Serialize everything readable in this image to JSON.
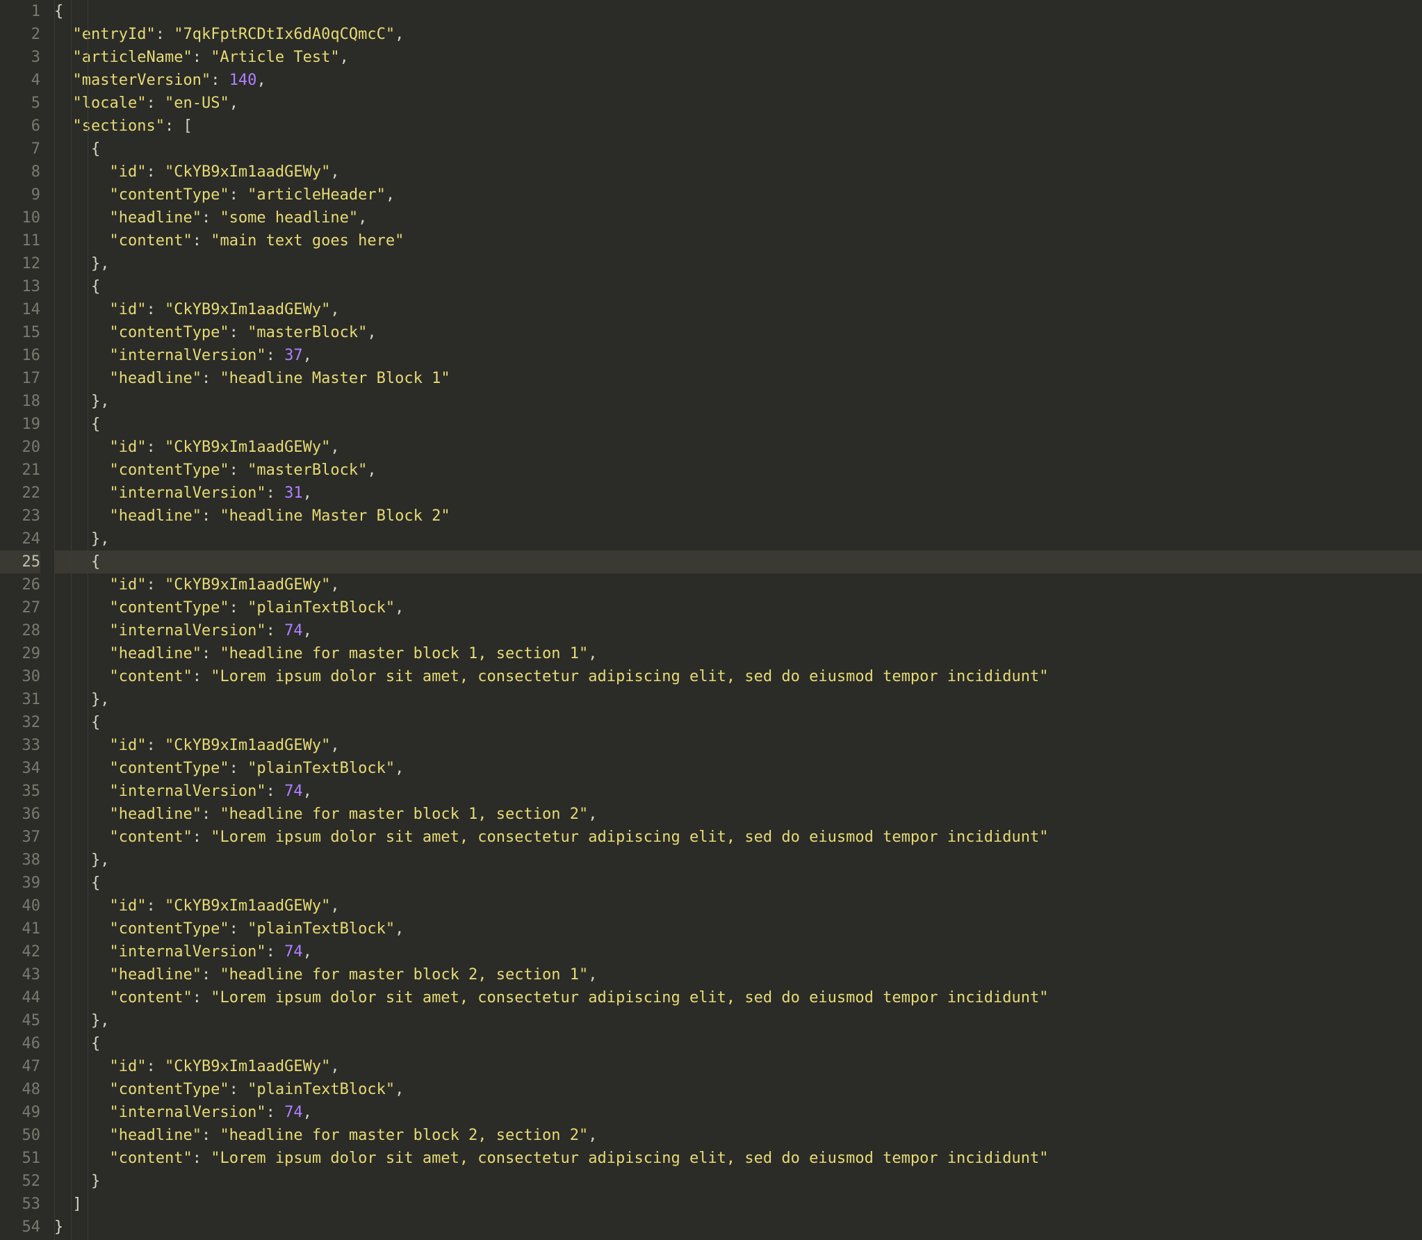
{
  "activeLine": 25,
  "lines": [
    {
      "n": 1,
      "indent": 0,
      "tokens": [
        {
          "t": "pn",
          "v": "{"
        }
      ]
    },
    {
      "n": 2,
      "indent": 1,
      "tokens": [
        {
          "t": "key",
          "v": "\"entryId\""
        },
        {
          "t": "pn",
          "v": ": "
        },
        {
          "t": "str",
          "v": "\"7qkFptRCDtIx6dA0qCQmcC\""
        },
        {
          "t": "pn",
          "v": ","
        }
      ]
    },
    {
      "n": 3,
      "indent": 1,
      "tokens": [
        {
          "t": "key",
          "v": "\"articleName\""
        },
        {
          "t": "pn",
          "v": ": "
        },
        {
          "t": "str",
          "v": "\"Article Test\""
        },
        {
          "t": "pn",
          "v": ","
        }
      ]
    },
    {
      "n": 4,
      "indent": 1,
      "tokens": [
        {
          "t": "key",
          "v": "\"masterVersion\""
        },
        {
          "t": "pn",
          "v": ": "
        },
        {
          "t": "num",
          "v": "140"
        },
        {
          "t": "pn",
          "v": ","
        }
      ]
    },
    {
      "n": 5,
      "indent": 1,
      "tokens": [
        {
          "t": "key",
          "v": "\"locale\""
        },
        {
          "t": "pn",
          "v": ": "
        },
        {
          "t": "str",
          "v": "\"en-US\""
        },
        {
          "t": "pn",
          "v": ","
        }
      ]
    },
    {
      "n": 6,
      "indent": 1,
      "tokens": [
        {
          "t": "key",
          "v": "\"sections\""
        },
        {
          "t": "pn",
          "v": ": ["
        }
      ]
    },
    {
      "n": 7,
      "indent": 2,
      "tokens": [
        {
          "t": "pn",
          "v": "{"
        }
      ]
    },
    {
      "n": 8,
      "indent": 3,
      "tokens": [
        {
          "t": "key",
          "v": "\"id\""
        },
        {
          "t": "pn",
          "v": ": "
        },
        {
          "t": "str",
          "v": "\"CkYB9xIm1aadGEWy\""
        },
        {
          "t": "pn",
          "v": ","
        }
      ]
    },
    {
      "n": 9,
      "indent": 3,
      "tokens": [
        {
          "t": "key",
          "v": "\"contentType\""
        },
        {
          "t": "pn",
          "v": ": "
        },
        {
          "t": "str",
          "v": "\"articleHeader\""
        },
        {
          "t": "pn",
          "v": ","
        }
      ]
    },
    {
      "n": 10,
      "indent": 3,
      "tokens": [
        {
          "t": "key",
          "v": "\"headline\""
        },
        {
          "t": "pn",
          "v": ": "
        },
        {
          "t": "str",
          "v": "\"some headline\""
        },
        {
          "t": "pn",
          "v": ","
        }
      ]
    },
    {
      "n": 11,
      "indent": 3,
      "tokens": [
        {
          "t": "key",
          "v": "\"content\""
        },
        {
          "t": "pn",
          "v": ": "
        },
        {
          "t": "str",
          "v": "\"main text goes here\""
        }
      ]
    },
    {
      "n": 12,
      "indent": 2,
      "tokens": [
        {
          "t": "pn",
          "v": "},"
        }
      ]
    },
    {
      "n": 13,
      "indent": 2,
      "tokens": [
        {
          "t": "pn",
          "v": "{"
        }
      ]
    },
    {
      "n": 14,
      "indent": 3,
      "tokens": [
        {
          "t": "key",
          "v": "\"id\""
        },
        {
          "t": "pn",
          "v": ": "
        },
        {
          "t": "str",
          "v": "\"CkYB9xIm1aadGEWy\""
        },
        {
          "t": "pn",
          "v": ","
        }
      ]
    },
    {
      "n": 15,
      "indent": 3,
      "tokens": [
        {
          "t": "key",
          "v": "\"contentType\""
        },
        {
          "t": "pn",
          "v": ": "
        },
        {
          "t": "str",
          "v": "\"masterBlock\""
        },
        {
          "t": "pn",
          "v": ","
        }
      ]
    },
    {
      "n": 16,
      "indent": 3,
      "tokens": [
        {
          "t": "key",
          "v": "\"internalVersion\""
        },
        {
          "t": "pn",
          "v": ": "
        },
        {
          "t": "num",
          "v": "37"
        },
        {
          "t": "pn",
          "v": ","
        }
      ]
    },
    {
      "n": 17,
      "indent": 3,
      "tokens": [
        {
          "t": "key",
          "v": "\"headline\""
        },
        {
          "t": "pn",
          "v": ": "
        },
        {
          "t": "str",
          "v": "\"headline Master Block 1\""
        }
      ]
    },
    {
      "n": 18,
      "indent": 2,
      "tokens": [
        {
          "t": "pn",
          "v": "},"
        }
      ]
    },
    {
      "n": 19,
      "indent": 2,
      "tokens": [
        {
          "t": "pn",
          "v": "{"
        }
      ]
    },
    {
      "n": 20,
      "indent": 3,
      "tokens": [
        {
          "t": "key",
          "v": "\"id\""
        },
        {
          "t": "pn",
          "v": ": "
        },
        {
          "t": "str",
          "v": "\"CkYB9xIm1aadGEWy\""
        },
        {
          "t": "pn",
          "v": ","
        }
      ]
    },
    {
      "n": 21,
      "indent": 3,
      "tokens": [
        {
          "t": "key",
          "v": "\"contentType\""
        },
        {
          "t": "pn",
          "v": ": "
        },
        {
          "t": "str",
          "v": "\"masterBlock\""
        },
        {
          "t": "pn",
          "v": ","
        }
      ]
    },
    {
      "n": 22,
      "indent": 3,
      "tokens": [
        {
          "t": "key",
          "v": "\"internalVersion\""
        },
        {
          "t": "pn",
          "v": ": "
        },
        {
          "t": "num",
          "v": "31"
        },
        {
          "t": "pn",
          "v": ","
        }
      ]
    },
    {
      "n": 23,
      "indent": 3,
      "tokens": [
        {
          "t": "key",
          "v": "\"headline\""
        },
        {
          "t": "pn",
          "v": ": "
        },
        {
          "t": "str",
          "v": "\"headline Master Block 2\""
        }
      ]
    },
    {
      "n": 24,
      "indent": 2,
      "tokens": [
        {
          "t": "pn",
          "v": "},"
        }
      ]
    },
    {
      "n": 25,
      "indent": 2,
      "tokens": [
        {
          "t": "pn",
          "v": "{"
        }
      ]
    },
    {
      "n": 26,
      "indent": 3,
      "tokens": [
        {
          "t": "key",
          "v": "\"id\""
        },
        {
          "t": "pn",
          "v": ": "
        },
        {
          "t": "str",
          "v": "\"CkYB9xIm1aadGEWy\""
        },
        {
          "t": "pn",
          "v": ","
        }
      ]
    },
    {
      "n": 27,
      "indent": 3,
      "tokens": [
        {
          "t": "key",
          "v": "\"contentType\""
        },
        {
          "t": "pn",
          "v": ": "
        },
        {
          "t": "str",
          "v": "\"plainTextBlock\""
        },
        {
          "t": "pn",
          "v": ","
        }
      ]
    },
    {
      "n": 28,
      "indent": 3,
      "tokens": [
        {
          "t": "key",
          "v": "\"internalVersion\""
        },
        {
          "t": "pn",
          "v": ": "
        },
        {
          "t": "num",
          "v": "74"
        },
        {
          "t": "pn",
          "v": ","
        }
      ]
    },
    {
      "n": 29,
      "indent": 3,
      "tokens": [
        {
          "t": "key",
          "v": "\"headline\""
        },
        {
          "t": "pn",
          "v": ": "
        },
        {
          "t": "str",
          "v": "\"headline for master block 1, section 1\""
        },
        {
          "t": "pn",
          "v": ","
        }
      ]
    },
    {
      "n": 30,
      "indent": 3,
      "tokens": [
        {
          "t": "key",
          "v": "\"content\""
        },
        {
          "t": "pn",
          "v": ": "
        },
        {
          "t": "str",
          "v": "\"Lorem ipsum dolor sit amet, consectetur adipiscing elit, sed do eiusmod tempor incididunt\""
        }
      ]
    },
    {
      "n": 31,
      "indent": 2,
      "tokens": [
        {
          "t": "pn",
          "v": "},"
        }
      ]
    },
    {
      "n": 32,
      "indent": 2,
      "tokens": [
        {
          "t": "pn",
          "v": "{"
        }
      ]
    },
    {
      "n": 33,
      "indent": 3,
      "tokens": [
        {
          "t": "key",
          "v": "\"id\""
        },
        {
          "t": "pn",
          "v": ": "
        },
        {
          "t": "str",
          "v": "\"CkYB9xIm1aadGEWy\""
        },
        {
          "t": "pn",
          "v": ","
        }
      ]
    },
    {
      "n": 34,
      "indent": 3,
      "tokens": [
        {
          "t": "key",
          "v": "\"contentType\""
        },
        {
          "t": "pn",
          "v": ": "
        },
        {
          "t": "str",
          "v": "\"plainTextBlock\""
        },
        {
          "t": "pn",
          "v": ","
        }
      ]
    },
    {
      "n": 35,
      "indent": 3,
      "tokens": [
        {
          "t": "key",
          "v": "\"internalVersion\""
        },
        {
          "t": "pn",
          "v": ": "
        },
        {
          "t": "num",
          "v": "74"
        },
        {
          "t": "pn",
          "v": ","
        }
      ]
    },
    {
      "n": 36,
      "indent": 3,
      "tokens": [
        {
          "t": "key",
          "v": "\"headline\""
        },
        {
          "t": "pn",
          "v": ": "
        },
        {
          "t": "str",
          "v": "\"headline for master block 1, section 2\""
        },
        {
          "t": "pn",
          "v": ","
        }
      ]
    },
    {
      "n": 37,
      "indent": 3,
      "tokens": [
        {
          "t": "key",
          "v": "\"content\""
        },
        {
          "t": "pn",
          "v": ": "
        },
        {
          "t": "str",
          "v": "\"Lorem ipsum dolor sit amet, consectetur adipiscing elit, sed do eiusmod tempor incididunt\""
        }
      ]
    },
    {
      "n": 38,
      "indent": 2,
      "tokens": [
        {
          "t": "pn",
          "v": "},"
        }
      ]
    },
    {
      "n": 39,
      "indent": 2,
      "tokens": [
        {
          "t": "pn",
          "v": "{"
        }
      ]
    },
    {
      "n": 40,
      "indent": 3,
      "tokens": [
        {
          "t": "key",
          "v": "\"id\""
        },
        {
          "t": "pn",
          "v": ": "
        },
        {
          "t": "str",
          "v": "\"CkYB9xIm1aadGEWy\""
        },
        {
          "t": "pn",
          "v": ","
        }
      ]
    },
    {
      "n": 41,
      "indent": 3,
      "tokens": [
        {
          "t": "key",
          "v": "\"contentType\""
        },
        {
          "t": "pn",
          "v": ": "
        },
        {
          "t": "str",
          "v": "\"plainTextBlock\""
        },
        {
          "t": "pn",
          "v": ","
        }
      ]
    },
    {
      "n": 42,
      "indent": 3,
      "tokens": [
        {
          "t": "key",
          "v": "\"internalVersion\""
        },
        {
          "t": "pn",
          "v": ": "
        },
        {
          "t": "num",
          "v": "74"
        },
        {
          "t": "pn",
          "v": ","
        }
      ]
    },
    {
      "n": 43,
      "indent": 3,
      "tokens": [
        {
          "t": "key",
          "v": "\"headline\""
        },
        {
          "t": "pn",
          "v": ": "
        },
        {
          "t": "str",
          "v": "\"headline for master block 2, section 1\""
        },
        {
          "t": "pn",
          "v": ","
        }
      ]
    },
    {
      "n": 44,
      "indent": 3,
      "tokens": [
        {
          "t": "key",
          "v": "\"content\""
        },
        {
          "t": "pn",
          "v": ": "
        },
        {
          "t": "str",
          "v": "\"Lorem ipsum dolor sit amet, consectetur adipiscing elit, sed do eiusmod tempor incididunt\""
        }
      ]
    },
    {
      "n": 45,
      "indent": 2,
      "tokens": [
        {
          "t": "pn",
          "v": "},"
        }
      ]
    },
    {
      "n": 46,
      "indent": 2,
      "tokens": [
        {
          "t": "pn",
          "v": "{"
        }
      ]
    },
    {
      "n": 47,
      "indent": 3,
      "tokens": [
        {
          "t": "key",
          "v": "\"id\""
        },
        {
          "t": "pn",
          "v": ": "
        },
        {
          "t": "str",
          "v": "\"CkYB9xIm1aadGEWy\""
        },
        {
          "t": "pn",
          "v": ","
        }
      ]
    },
    {
      "n": 48,
      "indent": 3,
      "tokens": [
        {
          "t": "key",
          "v": "\"contentType\""
        },
        {
          "t": "pn",
          "v": ": "
        },
        {
          "t": "str",
          "v": "\"plainTextBlock\""
        },
        {
          "t": "pn",
          "v": ","
        }
      ]
    },
    {
      "n": 49,
      "indent": 3,
      "tokens": [
        {
          "t": "key",
          "v": "\"internalVersion\""
        },
        {
          "t": "pn",
          "v": ": "
        },
        {
          "t": "num",
          "v": "74"
        },
        {
          "t": "pn",
          "v": ","
        }
      ]
    },
    {
      "n": 50,
      "indent": 3,
      "tokens": [
        {
          "t": "key",
          "v": "\"headline\""
        },
        {
          "t": "pn",
          "v": ": "
        },
        {
          "t": "str",
          "v": "\"headline for master block 2, section 2\""
        },
        {
          "t": "pn",
          "v": ","
        }
      ]
    },
    {
      "n": 51,
      "indent": 3,
      "tokens": [
        {
          "t": "key",
          "v": "\"content\""
        },
        {
          "t": "pn",
          "v": ": "
        },
        {
          "t": "str",
          "v": "\"Lorem ipsum dolor sit amet, consectetur adipiscing elit, sed do eiusmod tempor incididunt\""
        }
      ]
    },
    {
      "n": 52,
      "indent": 2,
      "tokens": [
        {
          "t": "pn",
          "v": "}"
        }
      ]
    },
    {
      "n": 53,
      "indent": 1,
      "tokens": [
        {
          "t": "pn",
          "v": "]"
        }
      ]
    },
    {
      "n": 54,
      "indent": 0,
      "tokens": [
        {
          "t": "pn",
          "v": "}"
        }
      ]
    }
  ]
}
